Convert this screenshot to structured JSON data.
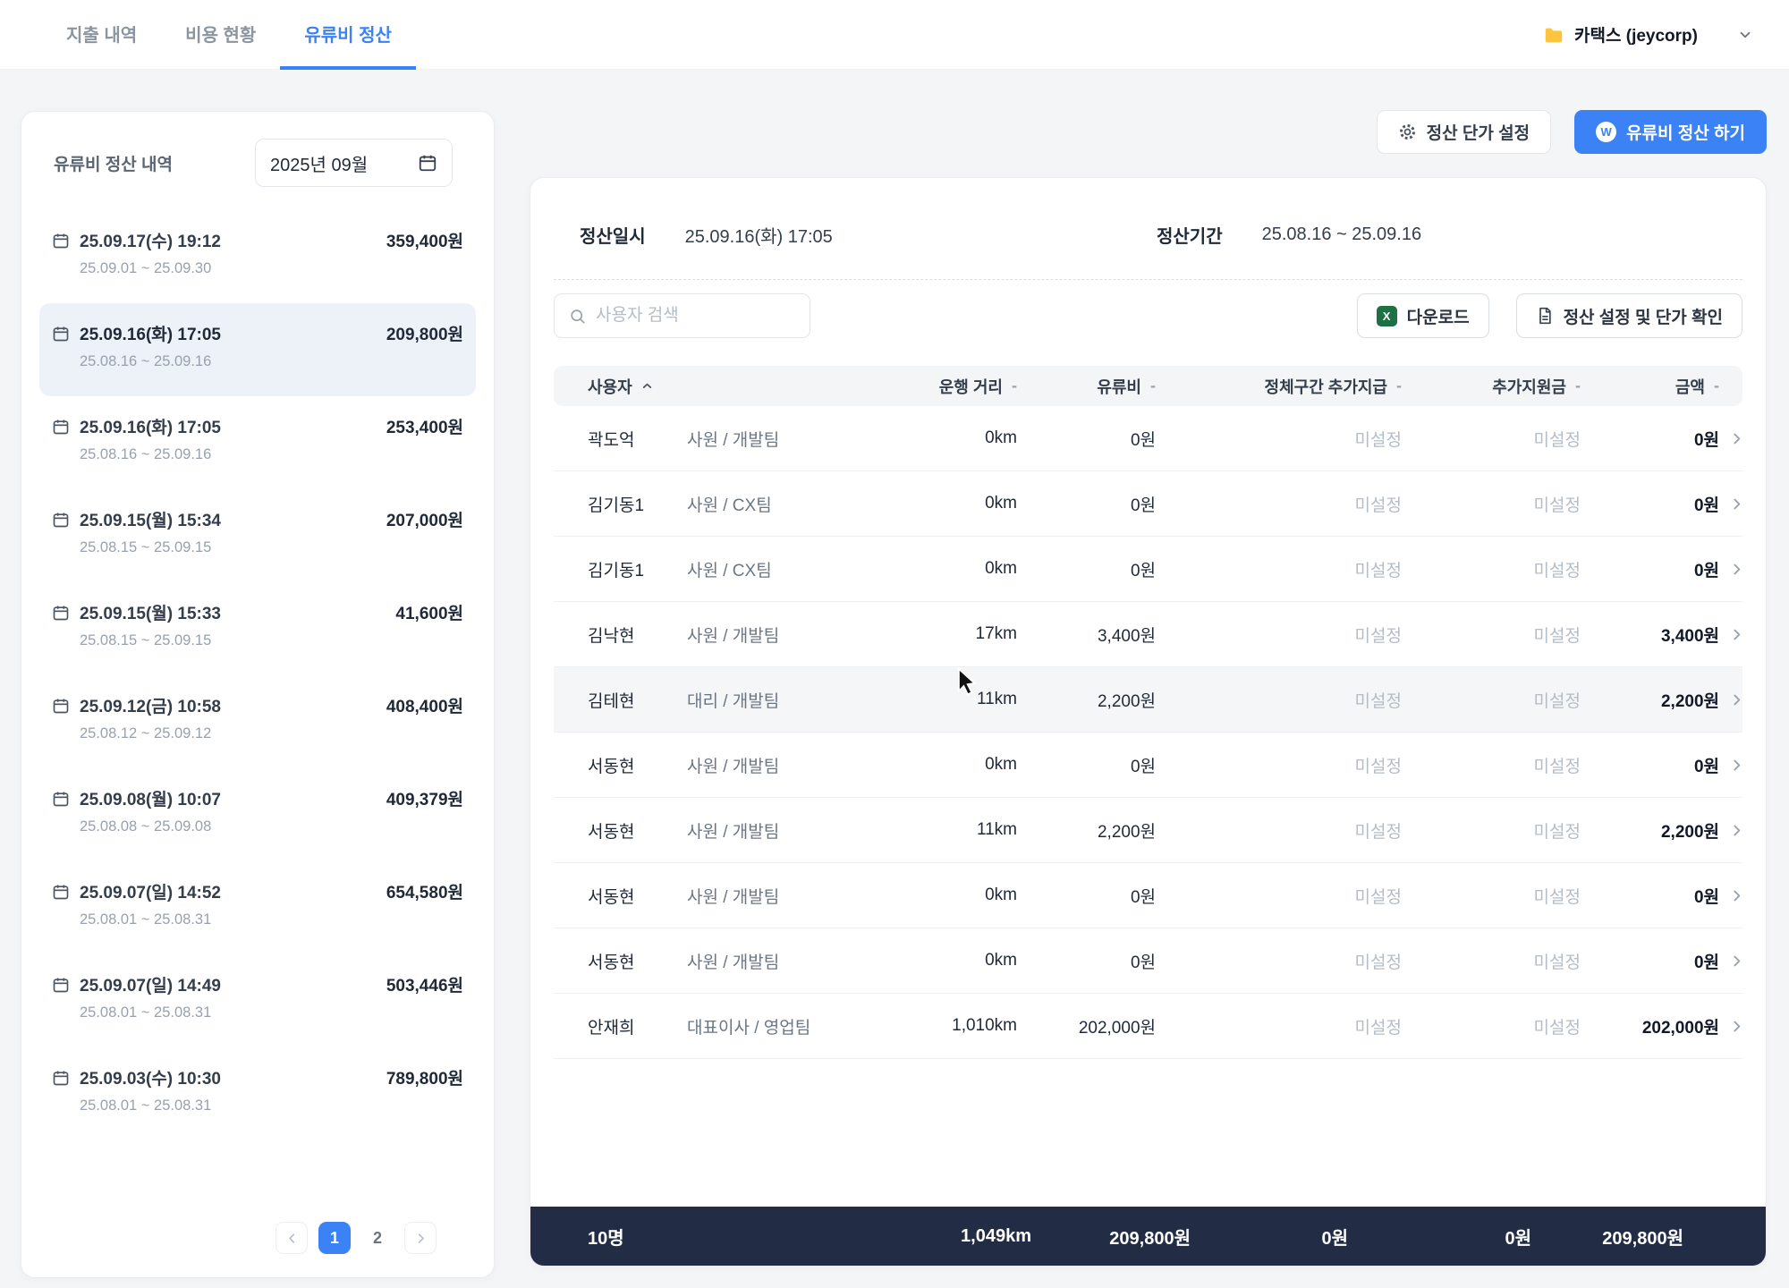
{
  "topnav": {
    "tabs": [
      {
        "label": "지출 내역"
      },
      {
        "label": "비용 현황"
      },
      {
        "label": "유류비 정산"
      }
    ],
    "active_tab": "유류비 정산",
    "account_label": "카택스 (jeycorp)"
  },
  "sidebar": {
    "title": "유류비 정산 내역",
    "month": "2025년 09월",
    "items": [
      {
        "datetime": "25.09.17(수) 19:12",
        "amount": "359,400원",
        "period": "25.09.01 ~ 25.09.30",
        "selected": false
      },
      {
        "datetime": "25.09.16(화) 17:05",
        "amount": "209,800원",
        "period": "25.08.16 ~ 25.09.16",
        "selected": true
      },
      {
        "datetime": "25.09.16(화) 17:05",
        "amount": "253,400원",
        "period": "25.08.16 ~ 25.09.16",
        "selected": false
      },
      {
        "datetime": "25.09.15(월) 15:34",
        "amount": "207,000원",
        "period": "25.08.15 ~ 25.09.15",
        "selected": false
      },
      {
        "datetime": "25.09.15(월) 15:33",
        "amount": "41,600원",
        "period": "25.08.15 ~ 25.09.15",
        "selected": false
      },
      {
        "datetime": "25.09.12(금) 10:58",
        "amount": "408,400원",
        "period": "25.08.12 ~ 25.09.12",
        "selected": false
      },
      {
        "datetime": "25.09.08(월) 10:07",
        "amount": "409,379원",
        "period": "25.08.08 ~ 25.09.08",
        "selected": false
      },
      {
        "datetime": "25.09.07(일) 14:52",
        "amount": "654,580원",
        "period": "25.08.01 ~ 25.08.31",
        "selected": false
      },
      {
        "datetime": "25.09.07(일) 14:49",
        "amount": "503,446원",
        "period": "25.08.01 ~ 25.08.31",
        "selected": false
      },
      {
        "datetime": "25.09.03(수) 10:30",
        "amount": "789,800원",
        "period": "25.08.01 ~ 25.08.31",
        "selected": false
      }
    ],
    "pagination": {
      "page1": "1",
      "page2": "2",
      "active": "1"
    }
  },
  "actions": {
    "unit_price_label": "정산 단가 설정",
    "settle_label": "유류비 정산 하기",
    "settle_icon_letter": "W"
  },
  "summary": {
    "settled_at_label": "정산일시",
    "settled_at_value": "25.09.16(화) 17:05",
    "period_label": "정산기간",
    "period_value": "25.08.16 ~ 25.09.16"
  },
  "controls": {
    "search_placeholder": "사용자 검색",
    "download_label": "다운로드",
    "excel_icon_letter": "X",
    "settings_label": "정산 설정 및 단가 확인"
  },
  "table": {
    "columns": [
      {
        "label": "사용자",
        "indicator": "asc"
      },
      {
        "label": "운행 거리",
        "indicator": "-"
      },
      {
        "label": "유류비",
        "indicator": "-"
      },
      {
        "label": "정체구간 추가지급",
        "indicator": "-"
      },
      {
        "label": "추가지원금",
        "indicator": "-"
      },
      {
        "label": "금액",
        "indicator": "-"
      }
    ],
    "rows": [
      {
        "name": "곽도억",
        "position": "사원 / 개발팀",
        "distance": "0km",
        "fuel": "0원",
        "congestion": "미설정",
        "support": "미설정",
        "amount": "0원",
        "hover": false
      },
      {
        "name": "김기동1",
        "position": "사원 / CX팀",
        "distance": "0km",
        "fuel": "0원",
        "congestion": "미설정",
        "support": "미설정",
        "amount": "0원",
        "hover": false
      },
      {
        "name": "김기동1",
        "position": "사원 / CX팀",
        "distance": "0km",
        "fuel": "0원",
        "congestion": "미설정",
        "support": "미설정",
        "amount": "0원",
        "hover": false
      },
      {
        "name": "김낙현",
        "position": "사원 / 개발팀",
        "distance": "17km",
        "fuel": "3,400원",
        "congestion": "미설정",
        "support": "미설정",
        "amount": "3,400원",
        "hover": false
      },
      {
        "name": "김테현",
        "position": "대리 / 개발팀",
        "distance": "11km",
        "fuel": "2,200원",
        "congestion": "미설정",
        "support": "미설정",
        "amount": "2,200원",
        "hover": true
      },
      {
        "name": "서동현",
        "position": "사원 / 개발팀",
        "distance": "0km",
        "fuel": "0원",
        "congestion": "미설정",
        "support": "미설정",
        "amount": "0원",
        "hover": false
      },
      {
        "name": "서동현",
        "position": "사원 / 개발팀",
        "distance": "11km",
        "fuel": "2,200원",
        "congestion": "미설정",
        "support": "미설정",
        "amount": "2,200원",
        "hover": false
      },
      {
        "name": "서동현",
        "position": "사원 / 개발팀",
        "distance": "0km",
        "fuel": "0원",
        "congestion": "미설정",
        "support": "미설정",
        "amount": "0원",
        "hover": false
      },
      {
        "name": "서동현",
        "position": "사원 / 개발팀",
        "distance": "0km",
        "fuel": "0원",
        "congestion": "미설정",
        "support": "미설정",
        "amount": "0원",
        "hover": false
      },
      {
        "name": "안재희",
        "position": "대표이사 / 영업팀",
        "distance": "1,010km",
        "fuel": "202,000원",
        "congestion": "미설정",
        "support": "미설정",
        "amount": "202,000원",
        "hover": false
      }
    ],
    "footer": {
      "count": "10명",
      "distance": "1,049km",
      "fuel": "209,800원",
      "congestion": "0원",
      "support": "0원",
      "total": "209,800원"
    }
  },
  "colors": {
    "accent": "#3b82f6",
    "footer_bg": "#222d45",
    "excel_green": "#1e7145",
    "brand_yellow": "#ffc43d"
  }
}
